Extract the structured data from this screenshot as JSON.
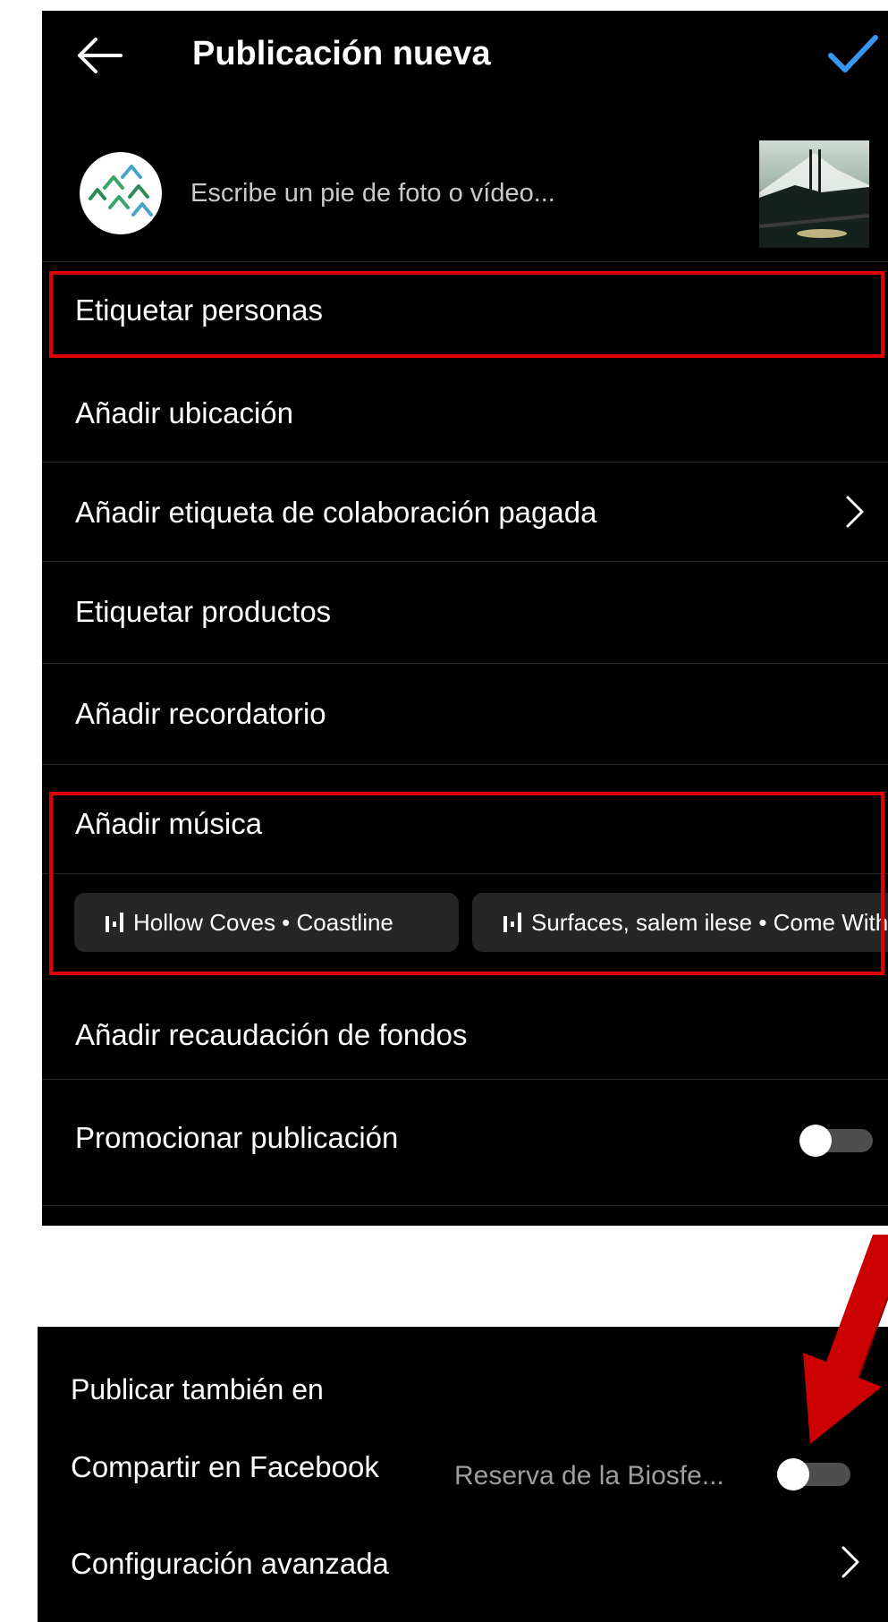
{
  "header": {
    "title": "Publicación nueva",
    "back_icon": "arrow-left-icon",
    "confirm_icon": "checkmark-icon",
    "accent_color": "#3797f0"
  },
  "caption": {
    "placeholder": "Escribe un pie de foto o vídeo...",
    "avatar_icon": "mountain-logo-icon"
  },
  "options": {
    "tag_people": "Etiquetar personas",
    "add_location": "Añadir ubicación",
    "paid_partnership": "Añadir etiqueta de colaboración pagada",
    "tag_products": "Etiquetar productos",
    "add_reminder": "Añadir recordatorio",
    "add_music": "Añadir música",
    "add_fundraiser": "Añadir recaudación de fondos",
    "promote_post": "Promocionar publicación"
  },
  "music_suggestions": [
    {
      "label": "Hollow Coves • Coastline"
    },
    {
      "label": "Surfaces, salem ilese • Come With Me"
    }
  ],
  "toggles": {
    "promote_post_on": false,
    "share_facebook_on": false
  },
  "share": {
    "section_title": "Publicar también en",
    "facebook_label": "Compartir en Facebook",
    "facebook_account": "Reserva de la Biosfe..."
  },
  "advanced": {
    "label": "Configuración avanzada"
  },
  "annotations": {
    "highlight_color": "#e00000",
    "arrow_color": "#cc0000"
  }
}
